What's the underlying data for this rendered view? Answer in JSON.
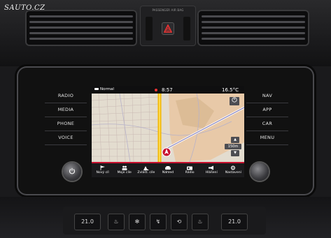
{
  "watermark": "SAUTO.CZ",
  "airbag_label": "PASSENGER AIR BAG",
  "left_buttons": [
    "RADIO",
    "MEDIA",
    "PHONE",
    "VOICE"
  ],
  "right_buttons": [
    "NAV",
    "APP",
    "CAR",
    "MENU"
  ],
  "status": {
    "profile": "Normal",
    "time": "8:57",
    "temperature": "16.5",
    "temperature_unit": "°C"
  },
  "map": {
    "compass_icon": "compass-icon",
    "scale_label": "150m"
  },
  "dock": [
    {
      "label": "Nový cíl",
      "icon": "flag-icon"
    },
    {
      "label": "Moje cíle",
      "icon": "people-icon"
    },
    {
      "label": "Zvlášt. cíle",
      "icon": "poi-icon"
    },
    {
      "label": "Náhled",
      "icon": "car-icon"
    },
    {
      "label": "Rádio",
      "icon": "radio-icon"
    },
    {
      "label": "Hlášení",
      "icon": "megaphone-icon"
    },
    {
      "label": "Nastavení",
      "icon": "settings-icon"
    }
  ],
  "climate": {
    "left_temp": "21.0",
    "right_temp": "21.0"
  },
  "colors": {
    "accent": "#c8102e",
    "route": "#f2b705",
    "screen_bg": "#d9cfc0"
  }
}
